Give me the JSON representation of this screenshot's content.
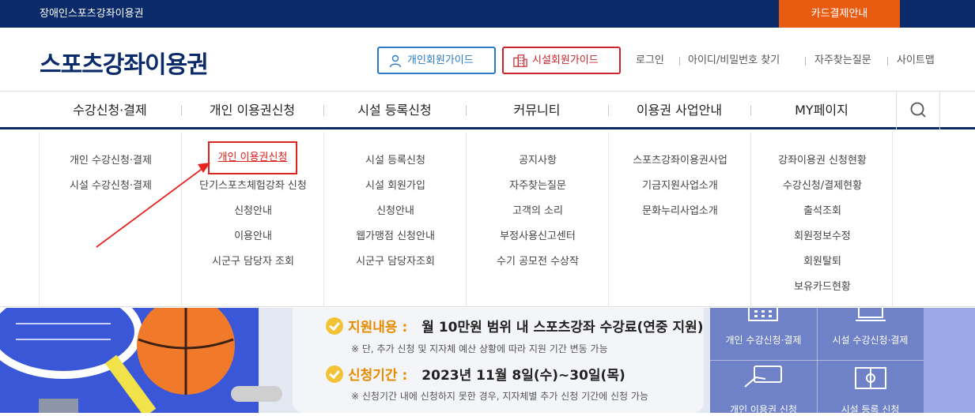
{
  "topbar": {
    "brand": "장애인스포츠강좌이용권",
    "card_payment": "카드결제안내"
  },
  "header": {
    "logo": "스포츠강좌이용권",
    "personal_guide": "개인회원가이드",
    "facility_guide": "시설회원가이드",
    "login": "로그인",
    "find_id_pw": "아이디/비밀번호 찾기",
    "faq": "자주찾는질문",
    "sitemap": "사이트맵"
  },
  "gnb": {
    "menus": [
      "수강신청·결제",
      "개인 이용권신청",
      "시설 등록신청",
      "커뮤니티",
      "이용권 사업안내",
      "MY페이지"
    ],
    "search_icon": "search-icon"
  },
  "mega": {
    "col1": [
      "개인 수강신청·결제",
      "시설 수강신청·결제"
    ],
    "col2": [
      "개인 이용권신청",
      "단기스포츠체험강좌 신청",
      "신청안내",
      "이용안내",
      "시군구 담당자 조회"
    ],
    "col3": [
      "시설 등록신청",
      "시설 회원가입",
      "신청안내",
      "웹가맹점 신청안내",
      "시군구 담당자조회"
    ],
    "col4": [
      "공지사항",
      "자주찾는질문",
      "고객의 소리",
      "부정사용신고센터",
      "수기 공모전 수상작"
    ],
    "col5": [
      "스포츠강좌이용권사업",
      "기금지원사업소개",
      "문화누리사업소개"
    ],
    "col6": [
      "강좌이용권 신청현황",
      "수강신청/결제현황",
      "출석조회",
      "회원정보수정",
      "회원탈퇴",
      "보유카드현황"
    ]
  },
  "banner": {
    "support_label": "지원내용 :",
    "support_value": "월 10만원 범위 내 스포츠강좌 수강료(연중 지원)",
    "support_note": "※ 단, 추가 신청 및 지자체 예산 상황에 따라 지원 기간 변동 가능",
    "period_label": "신청기간 :",
    "period_value": "2023년 11월 8일(수)~30일(목)",
    "period_note": "※ 신청기간 내에 신청하지 못한 경우, 지자체별 추가 신청 기간에 신청 가능",
    "quick_links": [
      "개인 수강신청·결제",
      "시설 수강신청·결제",
      "개인 이용권 신청",
      "시설 등록 신청"
    ]
  },
  "colors": {
    "navy": "#0a2a6a",
    "orange": "#ea5b12",
    "red": "#d9231d",
    "blue": "#2a7bc4"
  }
}
